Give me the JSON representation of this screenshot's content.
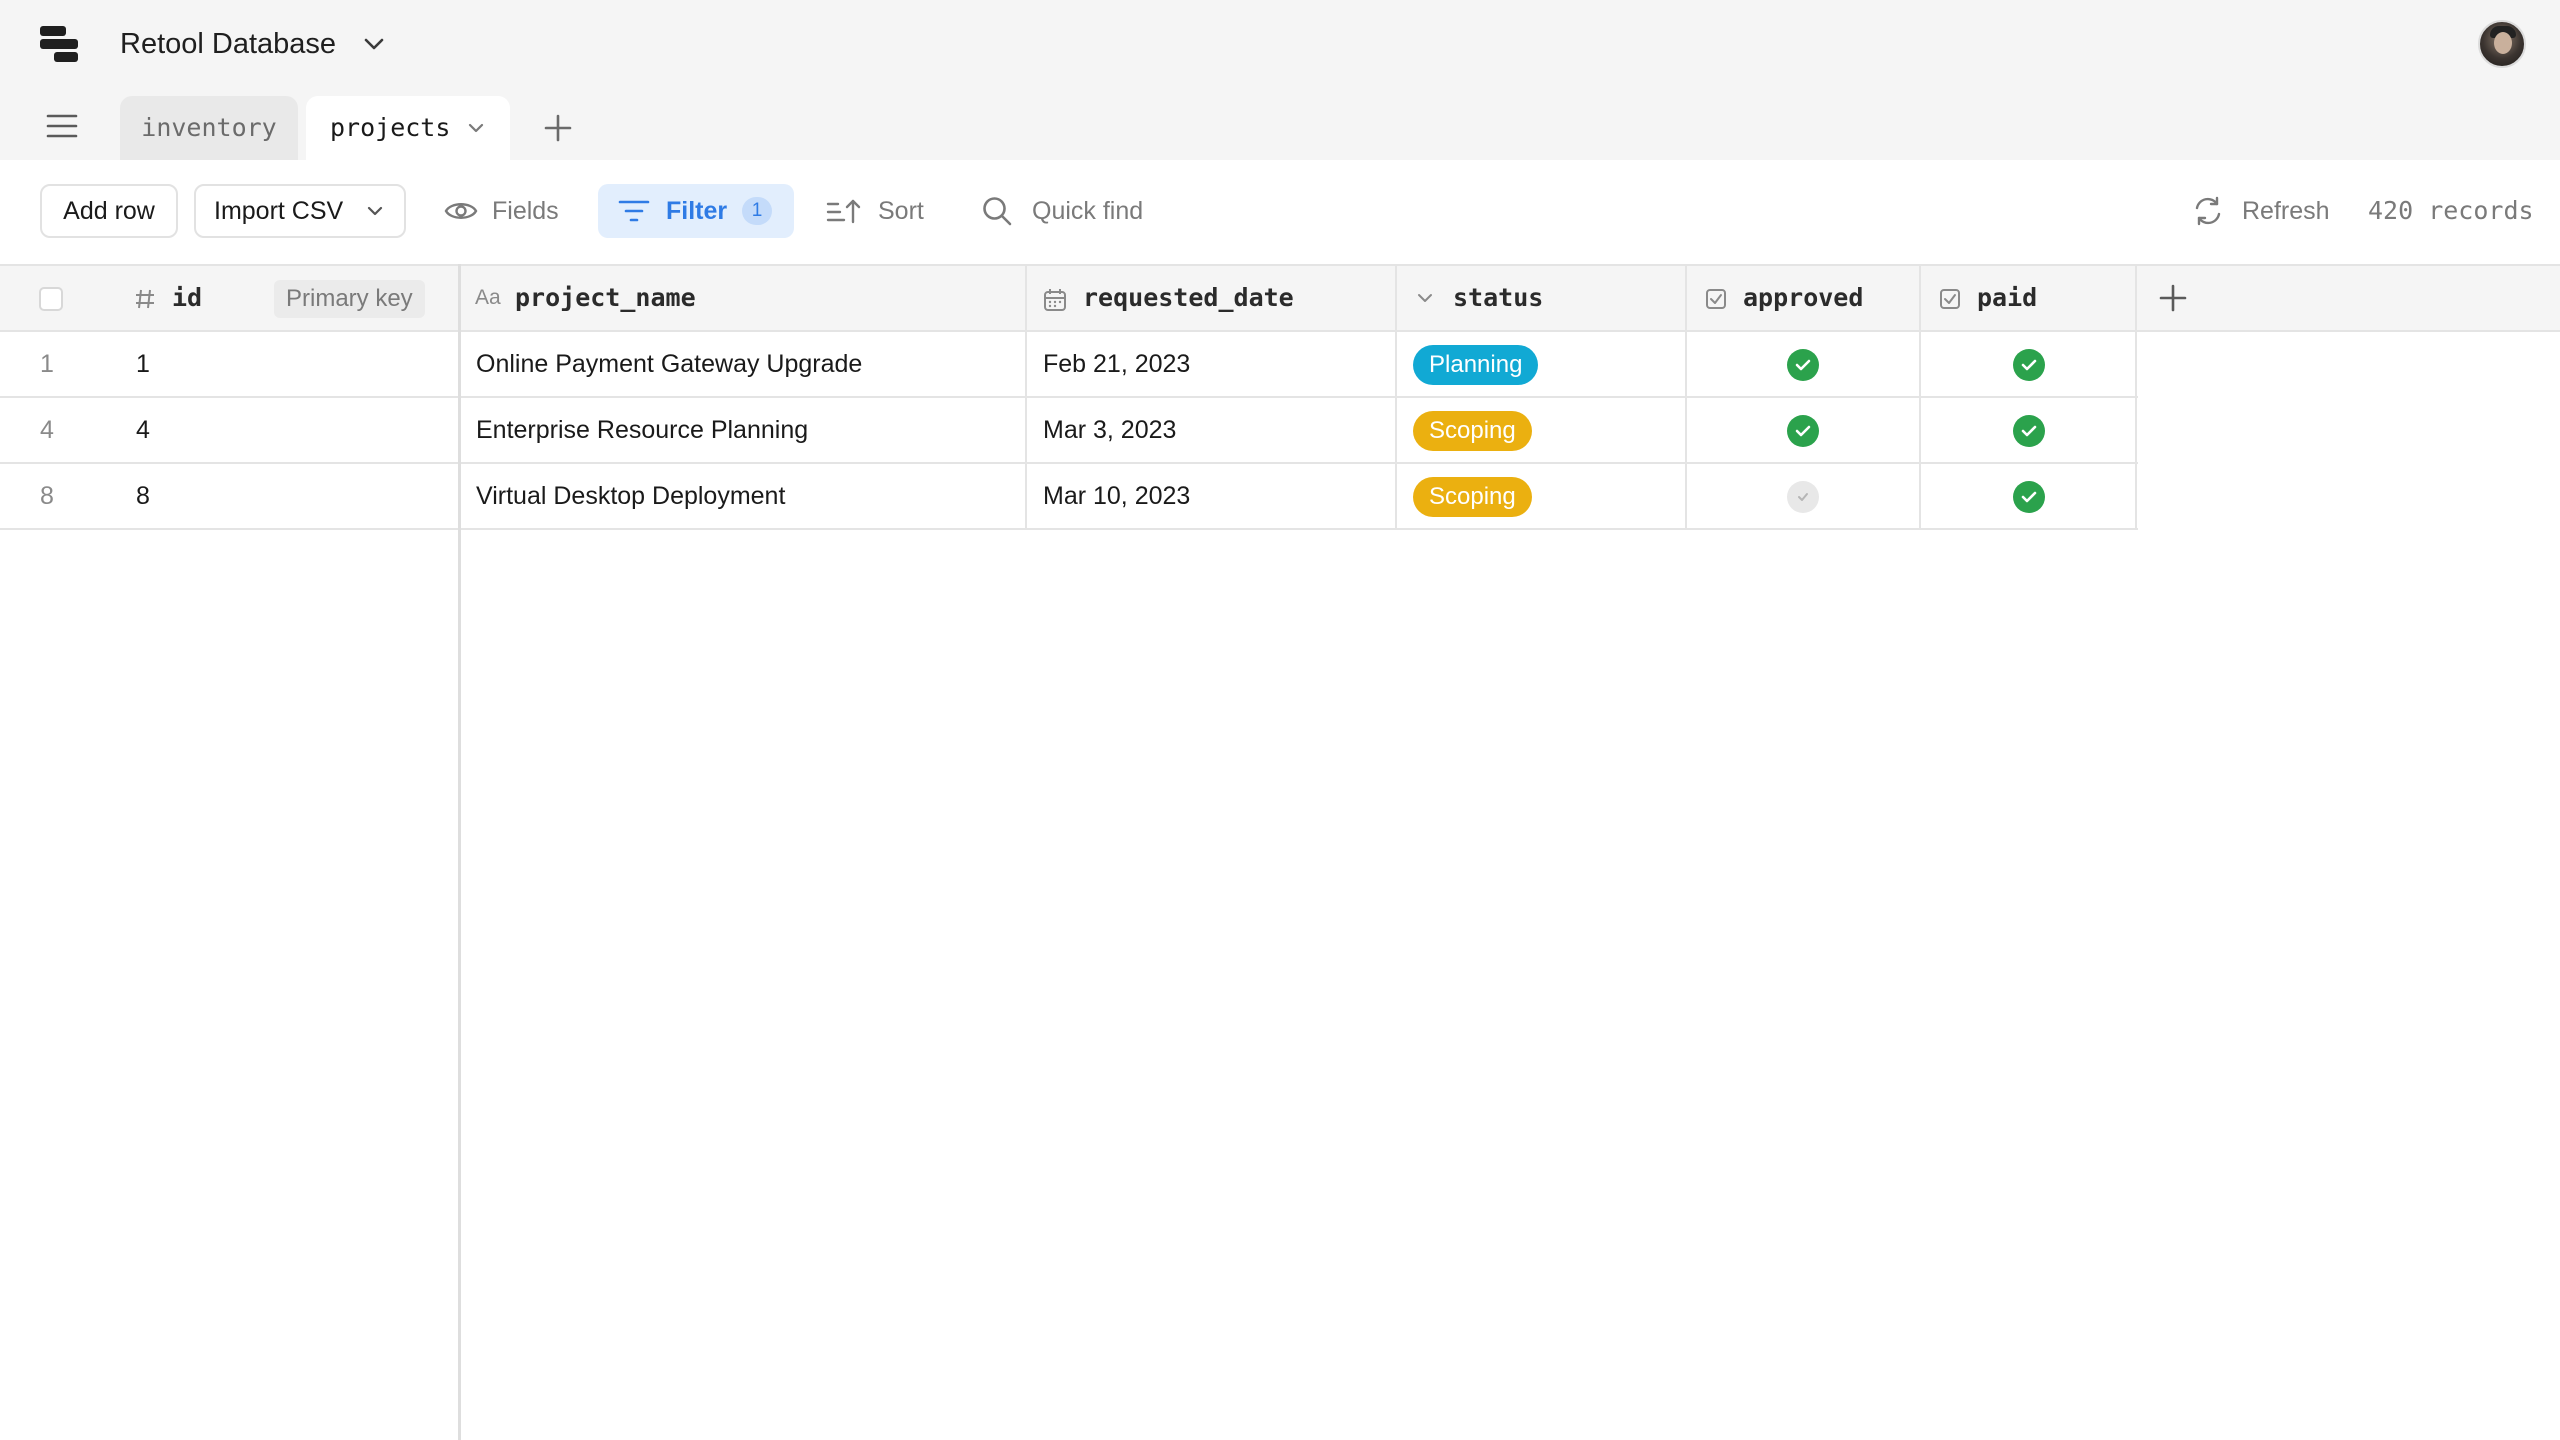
{
  "app": {
    "title": "Retool Database"
  },
  "tabs": [
    {
      "label": "inventory",
      "active": false
    },
    {
      "label": "projects",
      "active": true
    }
  ],
  "toolbar": {
    "add_row": "Add row",
    "import_csv": "Import CSV",
    "fields": "Fields",
    "filter": "Filter",
    "filter_count": "1",
    "sort": "Sort",
    "quick_find": "Quick find",
    "refresh": "Refresh",
    "record_count": "420 records"
  },
  "columns": {
    "id": "id",
    "id_badge": "Primary key",
    "project_name_type": "Aa",
    "project_name": "project_name",
    "requested_date": "requested_date",
    "status": "status",
    "approved": "approved",
    "paid": "paid"
  },
  "rows": [
    {
      "rownum": "1",
      "id": "1",
      "project_name": "Online Payment Gateway Upgrade",
      "requested_date": "Feb 21, 2023",
      "status": "Planning",
      "approved": true,
      "paid": true
    },
    {
      "rownum": "4",
      "id": "4",
      "project_name": "Enterprise Resource Planning",
      "requested_date": "Mar 3, 2023",
      "status": "Scoping",
      "approved": true,
      "paid": true
    },
    {
      "rownum": "8",
      "id": "8",
      "project_name": "Virtual Desktop Deployment",
      "requested_date": "Mar 10, 2023",
      "status": "Scoping",
      "approved": false,
      "paid": true
    }
  ],
  "colors": {
    "planning": "#11a9d4",
    "scoping": "#ebb010",
    "check_on": "#2ba24c",
    "check_off": "#e8e8e8",
    "filter_accent": "#2f7be5"
  }
}
